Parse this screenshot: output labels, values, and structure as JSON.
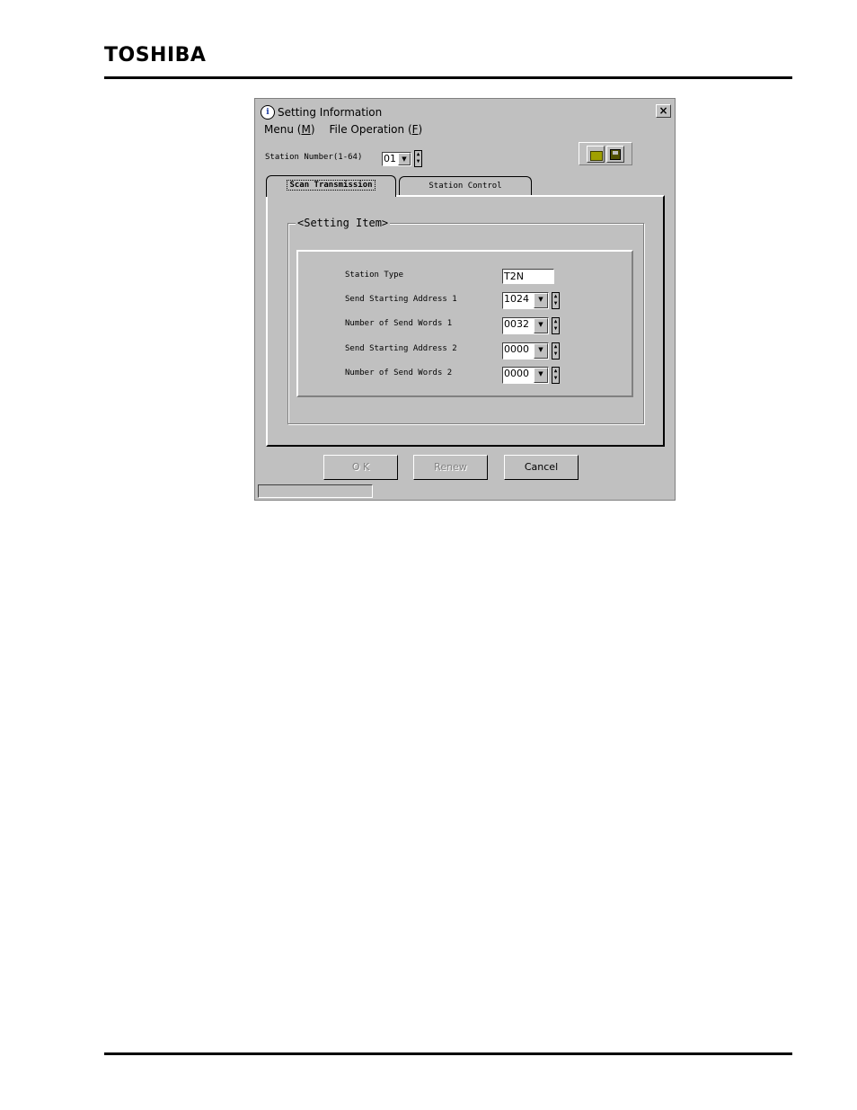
{
  "document": {
    "brand": "TOSHIBA"
  },
  "dialog": {
    "title": "Setting Information",
    "title_icon": "info-icon",
    "close_label": "×",
    "menu": [
      {
        "label": "Menu",
        "accel": "M"
      },
      {
        "label": "File Operation",
        "accel": "F"
      }
    ],
    "station_number_label": "Station Number(1-64)",
    "station_number_value": "01",
    "toolbar": {
      "open_icon": "folder-open-icon",
      "save_icon": "floppy-save-icon"
    },
    "tabs": [
      {
        "label": "Scan Transmission",
        "active": true
      },
      {
        "label": "Station Control",
        "active": false
      }
    ],
    "group_label": "<Setting Item>",
    "fields": [
      {
        "label": "Station Type",
        "value": "T2N",
        "type": "text"
      },
      {
        "label": "Send Starting Address 1",
        "value": "1024",
        "type": "combo"
      },
      {
        "label": "Number of Send Words 1",
        "value": "0032",
        "type": "combo"
      },
      {
        "label": "Send Starting Address 2",
        "value": "0000",
        "type": "combo"
      },
      {
        "label": "Number of Send Words 2",
        "value": "0000",
        "type": "combo"
      }
    ],
    "buttons": {
      "ok": "O K",
      "renew": "Renew",
      "cancel": "Cancel"
    },
    "status_text": ""
  }
}
